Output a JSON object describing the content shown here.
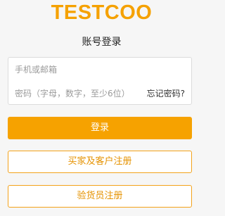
{
  "brand": {
    "logo_text": "TESTCOO"
  },
  "page": {
    "title": "账号登录"
  },
  "form": {
    "phone_placeholder": "手机或邮箱",
    "phone_value": "",
    "password_placeholder": "密码（字母，数字，至少6位）",
    "password_value": "",
    "forgot_label": "忘记密码?"
  },
  "actions": {
    "login_label": "登录",
    "buyer_register_label": "买家及客户注册",
    "inspector_register_label": "验货员注册"
  },
  "colors": {
    "accent": "#f6a200",
    "outline_text": "#e59200",
    "background": "#f6f6f6"
  }
}
